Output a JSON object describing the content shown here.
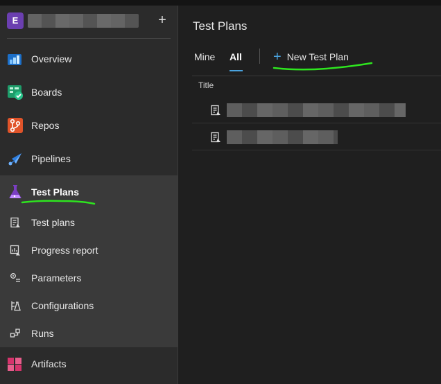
{
  "org": {
    "badge_letter": "E",
    "add_symbol": "+"
  },
  "sidebar": {
    "items": [
      {
        "label": "Overview",
        "icon": "overview-icon"
      },
      {
        "label": "Boards",
        "icon": "boards-icon"
      },
      {
        "label": "Repos",
        "icon": "repos-icon"
      },
      {
        "label": "Pipelines",
        "icon": "pipelines-icon"
      },
      {
        "label": "Test Plans",
        "icon": "test-plans-icon",
        "selected": true
      },
      {
        "label": "Artifacts",
        "icon": "artifacts-icon"
      }
    ],
    "subitems": [
      {
        "label": "Test plans",
        "icon": "test-plan-doc-icon"
      },
      {
        "label": "Progress report",
        "icon": "progress-report-icon"
      },
      {
        "label": "Parameters",
        "icon": "parameters-icon"
      },
      {
        "label": "Configurations",
        "icon": "configurations-icon"
      },
      {
        "label": "Runs",
        "icon": "runs-icon"
      }
    ]
  },
  "main": {
    "title": "Test Plans",
    "tabs": [
      {
        "label": "Mine"
      },
      {
        "label": "All",
        "active": true
      }
    ],
    "new_plan_symbol": "+",
    "new_plan_label": "New Test Plan",
    "column_title": "Title"
  },
  "colors": {
    "accent": "#4aa3df",
    "org_badge": "#6b3fb0",
    "annotation": "#2ee51f"
  }
}
